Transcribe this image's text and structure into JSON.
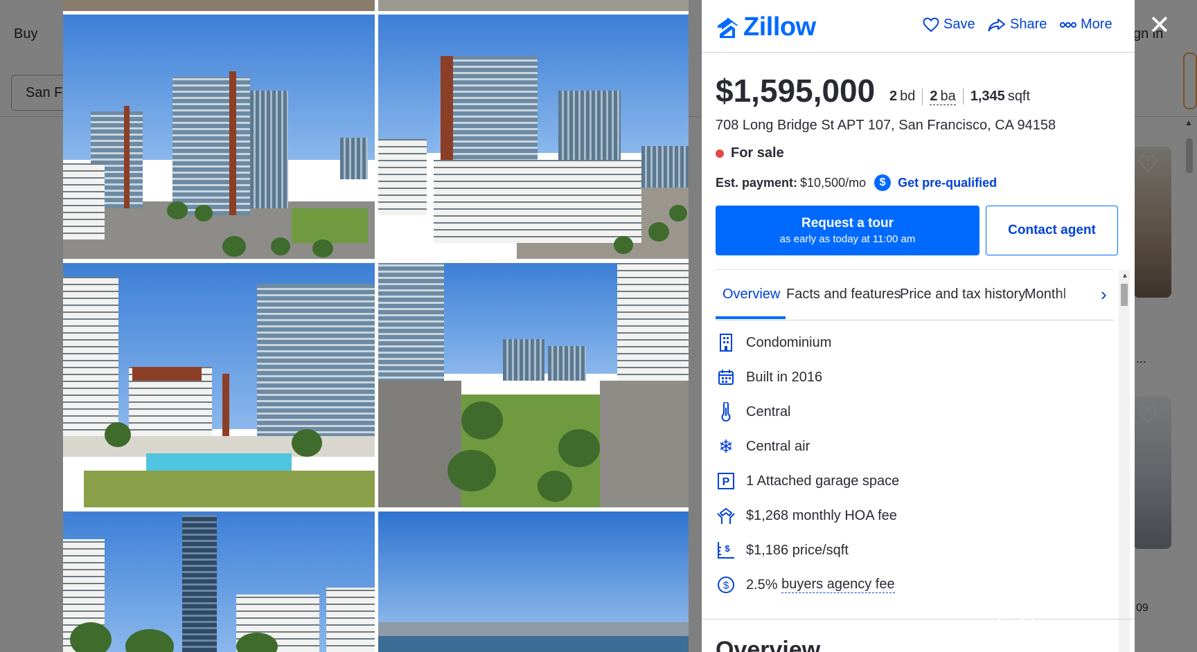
{
  "background": {
    "nav_buy": "Buy",
    "nav_signin": "gn in",
    "search_value": "San Fr",
    "card_ellipsis": "...",
    "card_small_text": "09"
  },
  "header": {
    "logo_text": "Zillow",
    "save_label": "Save",
    "share_label": "Share",
    "more_label": "More"
  },
  "listing": {
    "price": "$1,595,000",
    "beds_value": "2",
    "beds_unit": "bd",
    "baths_value": "2",
    "baths_unit": "ba",
    "sqft_value": "1,345",
    "sqft_unit": "sqft",
    "address": "708 Long Bridge St APT 107, San Francisco, CA 94158",
    "status": "For sale",
    "payment_label": "Est. payment:",
    "payment_value": "$10,500/mo",
    "prequal_label": "Get pre-qualified"
  },
  "actions": {
    "tour_title": "Request a tour",
    "tour_subtitle": "as early as today at 11:00 am",
    "contact_label": "Contact agent"
  },
  "tabs": [
    {
      "label": "Overview",
      "active": true
    },
    {
      "label": "Facts and features",
      "active": false
    },
    {
      "label": "Price and tax history",
      "active": false
    },
    {
      "label": "Monthl",
      "active": false
    }
  ],
  "facts": [
    {
      "icon": "building-icon",
      "text": "Condominium"
    },
    {
      "icon": "calendar-icon",
      "text": "Built in 2016"
    },
    {
      "icon": "thermometer-icon",
      "text": "Central"
    },
    {
      "icon": "snowflake-icon",
      "text": "Central air"
    },
    {
      "icon": "parking-icon",
      "text": "1 Attached garage space"
    },
    {
      "icon": "hoa-hands-icon",
      "text": "$1,268 monthly HOA fee"
    },
    {
      "icon": "price-sqft-icon",
      "text": "$1,186 price/sqft"
    },
    {
      "icon": "dollar-circle-icon",
      "text_prefix": "2.5% ",
      "text_link": "buyers agency fee"
    }
  ],
  "section_heading": "Overview",
  "watermark": "鱼片",
  "colors": {
    "brand_blue": "#006aff",
    "link_blue": "#0041d9",
    "status_red": "#e0494a",
    "text": "#2a2a33"
  }
}
